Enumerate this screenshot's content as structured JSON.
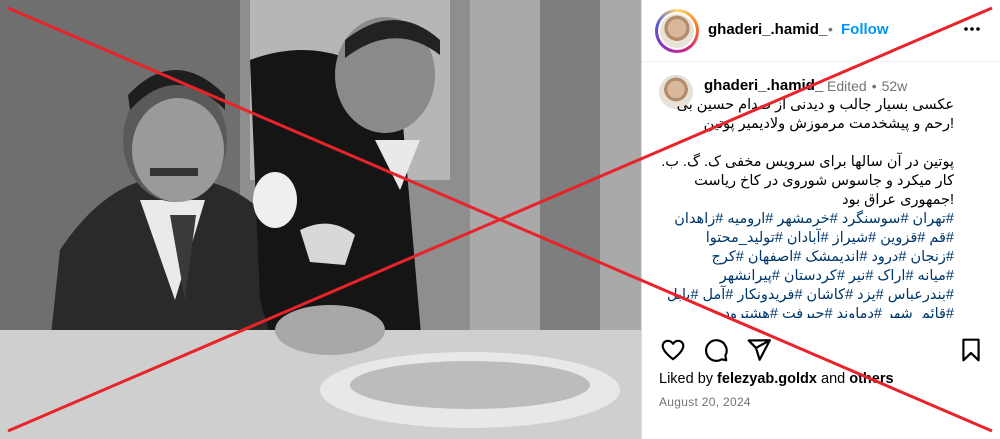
{
  "post": {
    "username": "ghaderi_.hamid_",
    "dot": "•",
    "follow_label": "Follow",
    "more_icon": "more-horizontal-icon"
  },
  "caption": {
    "username": "ghaderi_.hamid_",
    "edited": "Edited",
    "sep": "•",
    "age": "52w",
    "lines": [
      "عکسی بسیار جالب و دیدنی از صدام حسین بی",
      "!رحم و پیشخدمت مرموزش ولادیمیر پوتین",
      "",
      "پوتین در آن سالها برای سرویس مخفی ک. گ. ب.",
      "کار میکرد و جاسوس شوروی در کاخ ریاست",
      "!جمهوری عراق بود"
    ],
    "hashtag_lines": [
      "#تهران #سوسنگرد #خرمشهر #ارومیه #زاهدان",
      "#قم #قزوین #شیراز #آبادان #تولید_محتوا",
      "#زنجان #درود #اندیمشک #اصفهان #کرج",
      "#میانه #اراک #نیر #کردستان #پیرانشهر",
      "#بندرعباس #یزد #کاشان #فریدونکار #آمل #بابل",
      "#قائم_شهر #دماوند #جیرفت #هشترود"
    ]
  },
  "actions": {
    "like_icon": "heart-icon",
    "comment_icon": "comment-icon",
    "share_icon": "share-icon",
    "save_icon": "bookmark-icon"
  },
  "likes": {
    "prefix": "Liked by",
    "user": "felezyab.goldx",
    "conj": "and",
    "others": "others"
  },
  "date": "August 20, 2024",
  "overlay": {
    "cross_color": "#e8232a"
  },
  "colors": {
    "link": "#0095f6",
    "hashtag": "#00376b",
    "muted": "#737373"
  }
}
